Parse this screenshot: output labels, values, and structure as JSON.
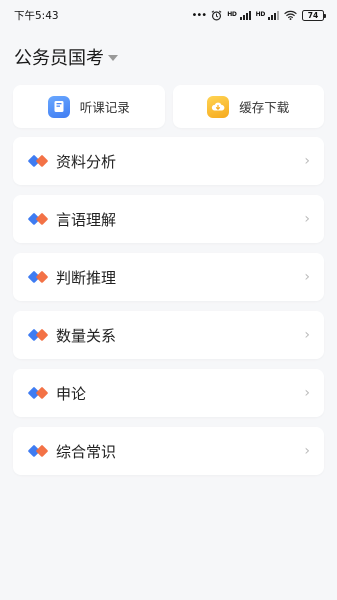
{
  "status": {
    "time": "下午5:43",
    "battery": "74",
    "hd1": "HD",
    "hd2": "HD"
  },
  "header": {
    "title": "公务员国考"
  },
  "quick": [
    {
      "label": "听课记录",
      "icon": "notebook-icon"
    },
    {
      "label": "缓存下载",
      "icon": "download-cloud-icon"
    }
  ],
  "subjects": [
    {
      "label": "资料分析"
    },
    {
      "label": "言语理解"
    },
    {
      "label": "判断推理"
    },
    {
      "label": "数量关系"
    },
    {
      "label": "申论"
    },
    {
      "label": "综合常识"
    }
  ],
  "colors": {
    "diamond_blue": "#3f7cf2",
    "diamond_orange": "#f26a3c",
    "background": "#f6f7f9"
  }
}
